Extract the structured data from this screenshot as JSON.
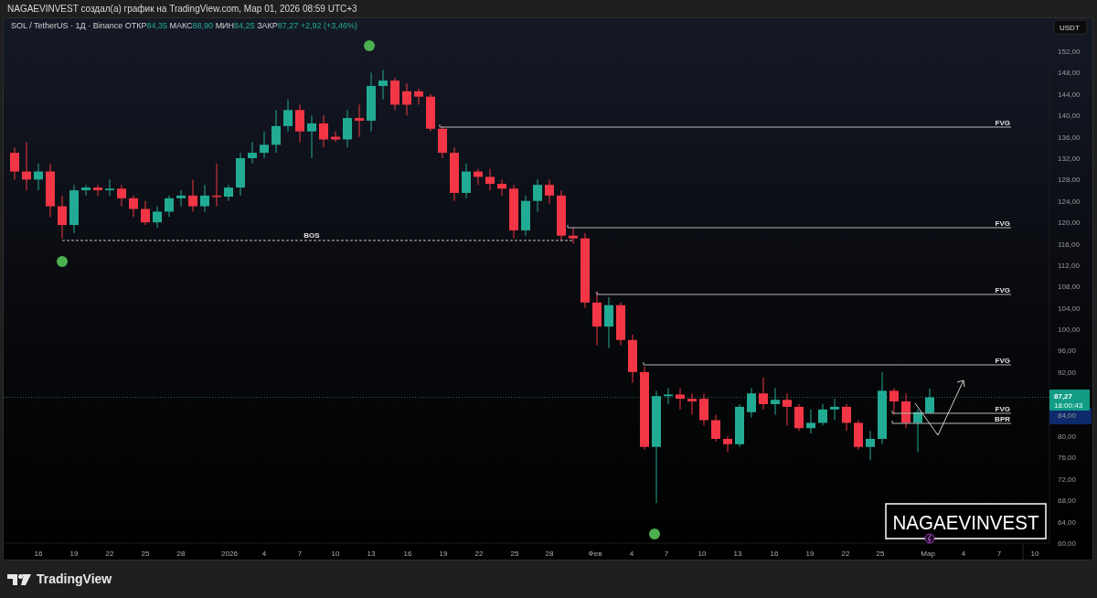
{
  "header": {
    "title": "NAGAEVINVEST создал(а) график на TradingView.com, Мар 01, 2026 08:59 UTC+3"
  },
  "legend": {
    "symbol": "SOL / TetherUS · 1Д · Binance",
    "values": [
      {
        "label": "ОТКР",
        "value": "84,35"
      },
      {
        "label": "МАКС",
        "value": "88,90"
      },
      {
        "label": "МИН",
        "value": "84,25"
      },
      {
        "label": "ЗАКР",
        "value": "87,27"
      }
    ],
    "change": "+2,92 (+3,46%)"
  },
  "price_axis": {
    "currency": "USDT",
    "labels": [
      "152,00",
      "148,00",
      "144,00",
      "140,00",
      "136,00",
      "132,00",
      "128,00",
      "124,00",
      "120,00",
      "116,00",
      "112,00",
      "108,00",
      "104,00",
      "100,00",
      "96,00",
      "92,00",
      "84,00",
      "80,00",
      "76,00",
      "72,00",
      "68,00",
      "64,00",
      "60,00"
    ]
  },
  "last_price": {
    "value": "87,27",
    "countdown": "18:00:43"
  },
  "time_axis": {
    "labels": [
      "16",
      "19",
      "22",
      "25",
      "28",
      "2026",
      "4",
      "7",
      "10",
      "13",
      "16",
      "19",
      "22",
      "25",
      "28",
      "Фев",
      "4",
      "7",
      "10",
      "13",
      "16",
      "19",
      "22",
      "25",
      "Мар",
      "4",
      "7",
      "10"
    ]
  },
  "annotations": [
    {
      "kind": "level",
      "label": "FVG"
    },
    {
      "kind": "level",
      "label": "FVG"
    },
    {
      "kind": "level",
      "label": "FVG"
    },
    {
      "kind": "level",
      "label": "FVG"
    },
    {
      "kind": "level",
      "label": "FVG"
    },
    {
      "kind": "level",
      "label": "BPR"
    },
    {
      "kind": "break",
      "label": "BOS"
    }
  ],
  "branding": {
    "overlay": "NAGAEVINVEST",
    "logo": "TradingView"
  }
}
